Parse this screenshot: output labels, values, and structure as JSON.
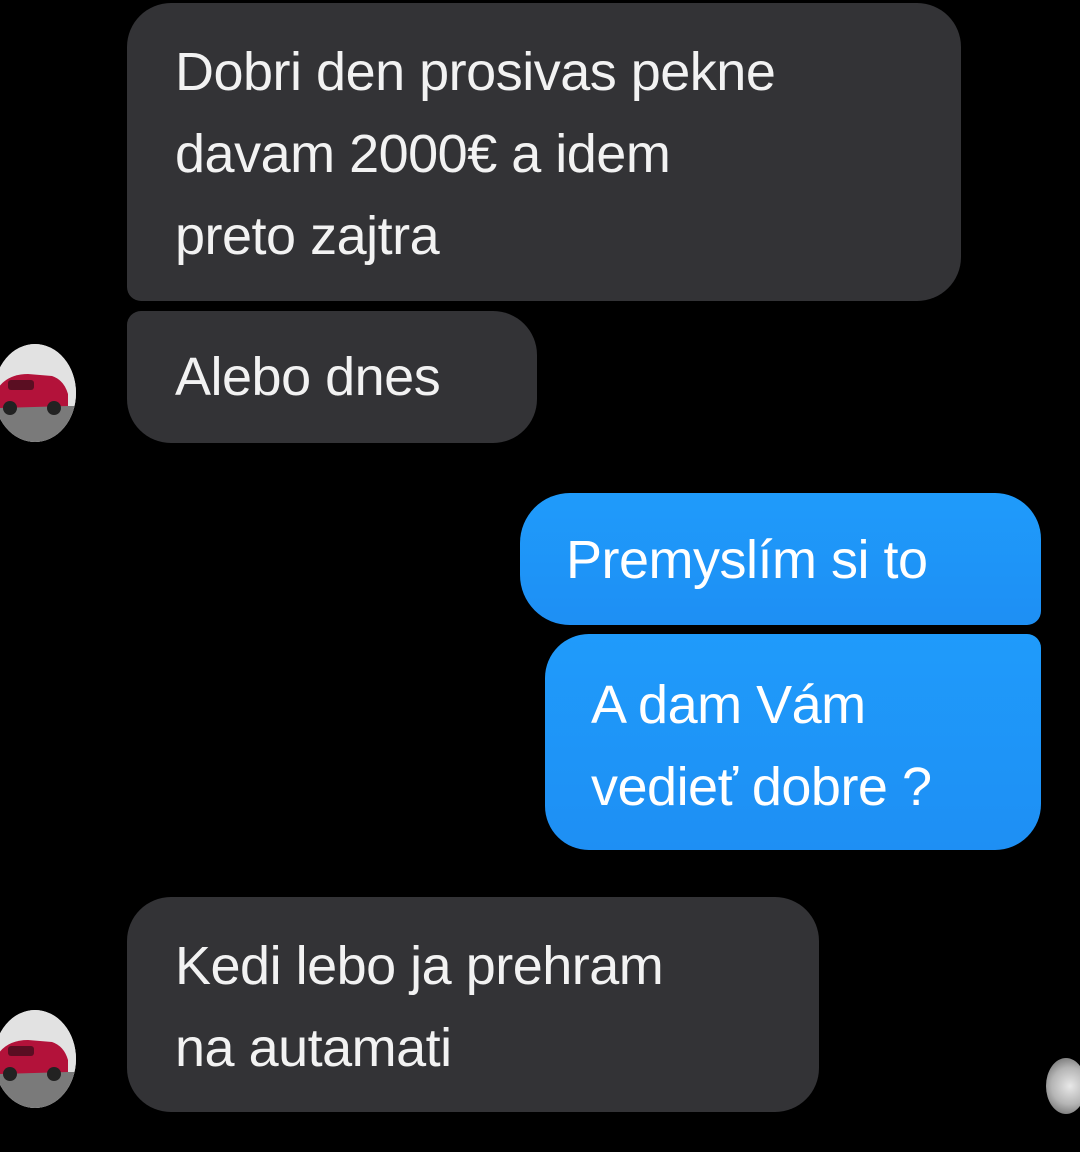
{
  "conversation": {
    "messages": [
      {
        "sender": "contact",
        "lines": [
          "Dobri den prosivas pekne",
          "davam 2000€ a idem",
          "preto zajtra"
        ]
      },
      {
        "sender": "contact",
        "lines": [
          "Alebo dnes"
        ]
      },
      {
        "sender": "me",
        "lines": [
          "Premyslím si to"
        ]
      },
      {
        "sender": "me",
        "lines": [
          "A dam Vám",
          "vedieť dobre ?"
        ]
      },
      {
        "sender": "contact",
        "lines": [
          "Kedi lebo ja prehram",
          "na autamati"
        ]
      }
    ]
  },
  "icons": {
    "contact_avatar": "car-photo-avatar",
    "read_receipt": "seen-avatar-icon"
  },
  "colors": {
    "background": "#000000",
    "incoming_bubble": "#333336",
    "outgoing_bubble": "#1e90f6",
    "text": "#ffffff"
  }
}
